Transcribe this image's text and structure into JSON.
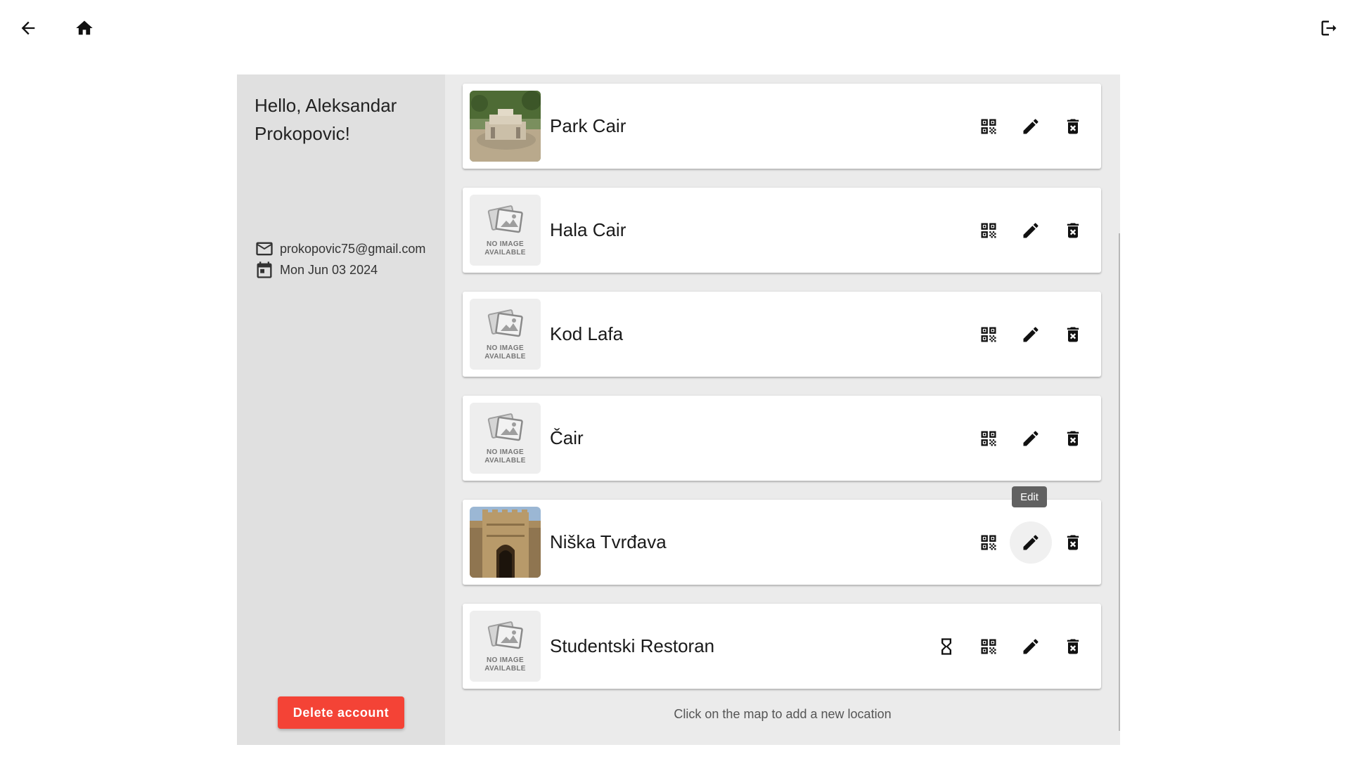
{
  "topbar": {
    "back_icon": "arrow-back-icon",
    "home_icon": "home-icon",
    "logout_icon": "logout-icon"
  },
  "profile": {
    "greeting": "Hello, Aleksandar Prokopovic!",
    "email": "prokopovic75@gmail.com",
    "date": "Mon Jun 03 2024",
    "delete_label": "Delete account"
  },
  "locations": [
    {
      "name": "Park Cair",
      "image": "photo-park"
    },
    {
      "name": "Hala Cair",
      "image": "no-image"
    },
    {
      "name": "Kod Lafa",
      "image": "no-image"
    },
    {
      "name": "Čair",
      "image": "no-image"
    },
    {
      "name": "Niška Tvrđava",
      "image": "photo-fortress"
    },
    {
      "name": "Studentski Restoran",
      "image": "no-image",
      "pending": true
    }
  ],
  "no_image_text": {
    "line1": "NO IMAGE",
    "line2": "AVAILABLE"
  },
  "tooltip": "Edit",
  "footer": "Click on the map to add a new location",
  "colors": {
    "delete": "#f44336",
    "sidebar": "#e0e0e0",
    "panel": "#ebebeb",
    "tooltip": "#616161"
  }
}
